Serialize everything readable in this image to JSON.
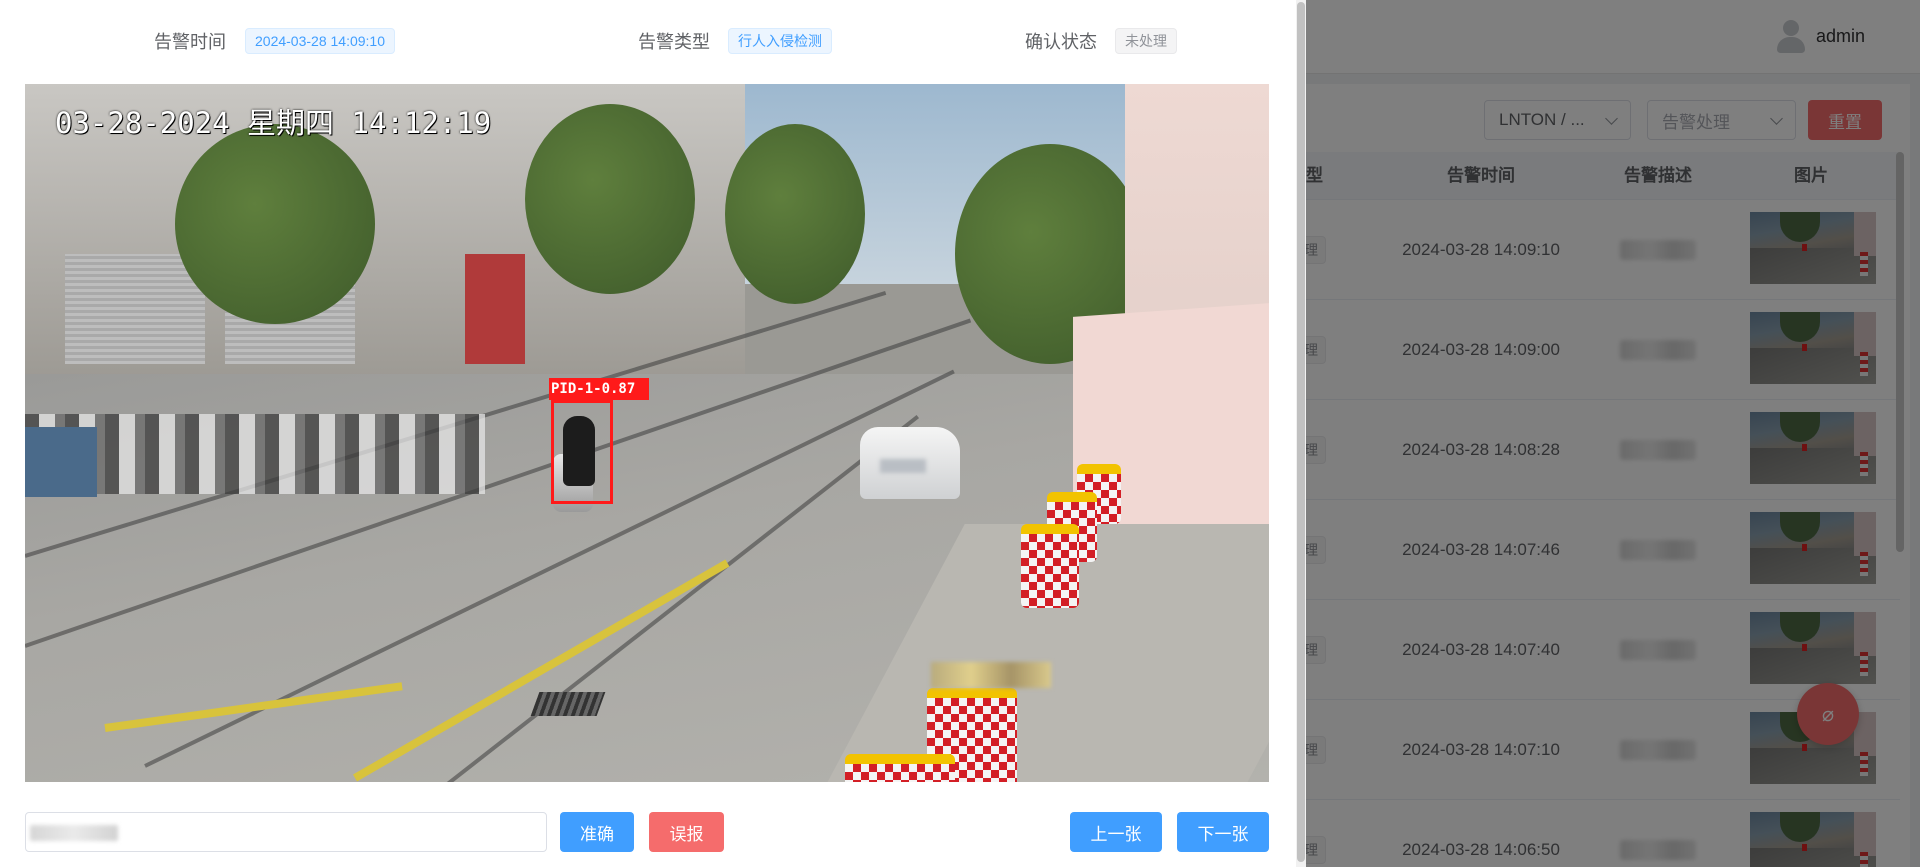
{
  "background_page": {
    "username": "admin",
    "filters": {
      "device_select": "LNTON / ...",
      "handling_select_placeholder": "告警处理",
      "reset_button": "重置"
    },
    "table": {
      "columns": [
        "类型",
        "告警时间",
        "告警描述",
        "图片"
      ],
      "rows": [
        {
          "tag": "理",
          "time": "2024-03-28 14:09:10"
        },
        {
          "tag": "理",
          "time": "2024-03-28 14:09:00"
        },
        {
          "tag": "理",
          "time": "2024-03-28 14:08:28"
        },
        {
          "tag": "理",
          "time": "2024-03-28 14:07:46"
        },
        {
          "tag": "理",
          "time": "2024-03-28 14:07:40"
        },
        {
          "tag": "理",
          "time": "2024-03-28 14:07:10"
        },
        {
          "tag": "理",
          "time": "2024-03-28 14:06:50"
        }
      ]
    },
    "fab_icon": "bell-off-icon",
    "fab_glyph": "⌀"
  },
  "dialog": {
    "alarm_time_label": "告警时间",
    "alarm_time_value": "2024-03-28 14:09:10",
    "alarm_type_label": "告警类型",
    "alarm_type_value": "行人入侵检测",
    "confirm_status_label": "确认状态",
    "confirm_status_value": "未处理",
    "snapshot": {
      "osd_timestamp": "03-28-2024 星期四 14:12:19",
      "detection_label": "PID-1-0.87"
    },
    "buttons": {
      "accurate": "准确",
      "false_alarm": "误报",
      "previous": "上一张",
      "next": "下一张"
    }
  },
  "colors": {
    "primary": "#409eff",
    "danger": "#f56c6c",
    "detection_box": "#ff1a1a"
  }
}
